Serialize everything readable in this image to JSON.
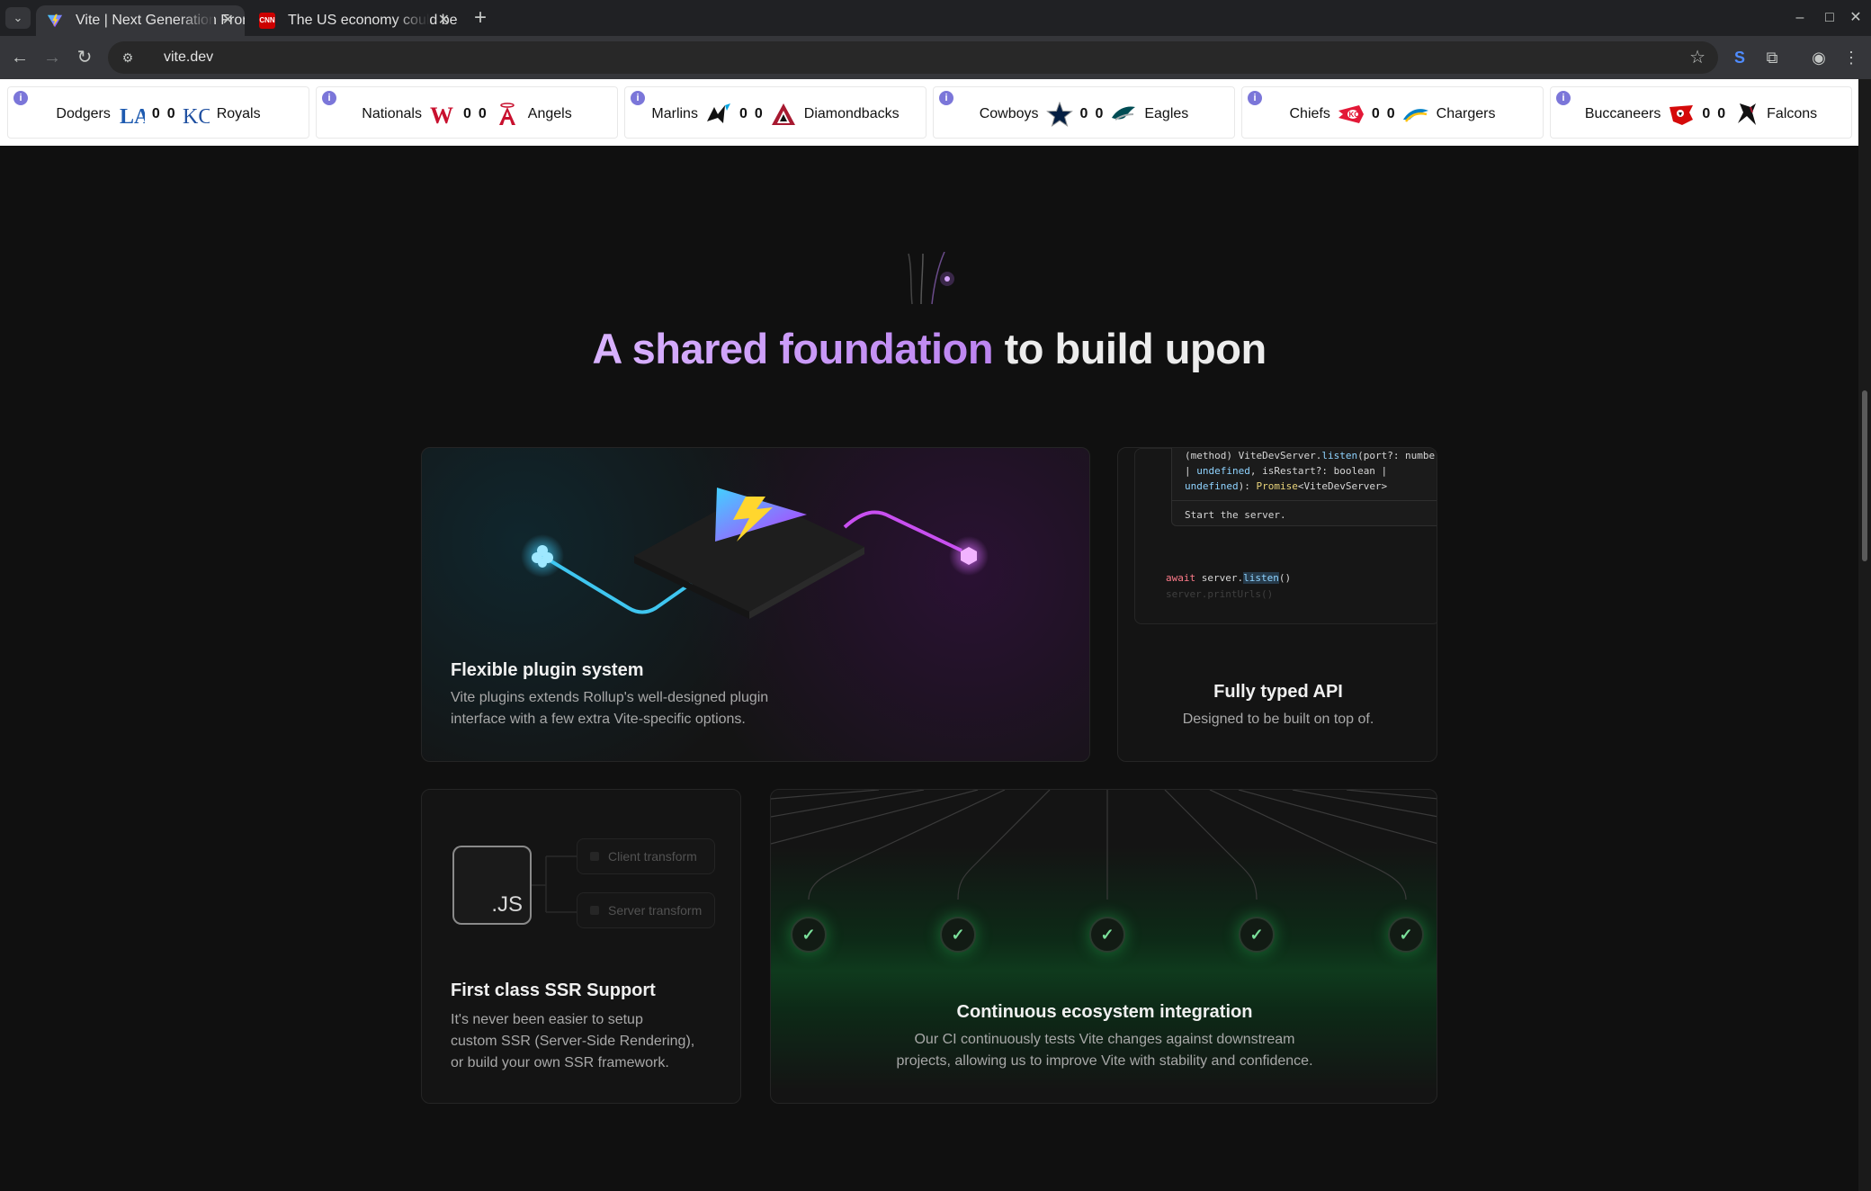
{
  "browser": {
    "tabs": [
      {
        "title": "Vite | Next Generation Frontend Tooling",
        "active": true
      },
      {
        "title": "The US economy could be in for a rough ride",
        "active": false
      }
    ],
    "url": "vite.dev"
  },
  "scores": [
    {
      "away": "Dodgers",
      "away_score": "0",
      "home_score": "0",
      "home": "Royals"
    },
    {
      "away": "Nationals",
      "away_score": "0",
      "home_score": "0",
      "home": "Angels"
    },
    {
      "away": "Marlins",
      "away_score": "0",
      "home_score": "0",
      "home": "Diamondbacks"
    },
    {
      "away": "Cowboys",
      "away_score": "0",
      "home_score": "0",
      "home": "Eagles"
    },
    {
      "away": "Chiefs",
      "away_score": "0",
      "home_score": "0",
      "home": "Chargers"
    },
    {
      "away": "Buccaneers",
      "away_score": "0",
      "home_score": "0",
      "home": "Falcons"
    }
  ],
  "section": {
    "heading_accent": "A shared foundation",
    "heading_rest": " to build upon"
  },
  "cards": {
    "plugin": {
      "title": "Flexible plugin system",
      "desc_line1": "Vite plugins extends Rollup's well-designed plugin",
      "desc_line2": "interface with a few extra Vite-specific options."
    },
    "typed": {
      "title": "Fully typed API",
      "desc": "Designed to be built on top of.",
      "tooltip": {
        "method": "(method) ViteDevServer.",
        "fn": "listen",
        "params1": "(port?: number",
        "line2_a": "| ",
        "line2_b": "undefined",
        "line2_c": ", isRestart?: boolean |",
        "line3_a": "undefined",
        "line3_b": "): ",
        "line3_c": "Promise",
        "line3_d": "<ViteDevServer>",
        "doc": "Start the server."
      },
      "code_line1_kw": "await",
      "code_line1_obj": " server.",
      "code_line1_fn": "listen",
      "code_line1_end": "()",
      "code_line2": "server.printUrls()"
    },
    "ssr": {
      "title": "First class SSR Support",
      "desc_line1": "It's never been easier to setup",
      "desc_line2": "custom SSR (Server-Side Rendering),",
      "desc_line3": "or build your own SSR framework.",
      "js_label": ".JS",
      "client": "Client transform",
      "server": "Server transform"
    },
    "ci": {
      "title": "Continuous ecosystem integration",
      "desc_line1": "Our CI continuously tests Vite changes against downstream",
      "desc_line2": "projects, allowing us to improve Vite with stability and confidence."
    }
  },
  "colors": {
    "accent_purple": "#c894f5",
    "vite_blue": "#41d1ff",
    "vite_purple": "#bd34fe",
    "ci_green": "#2bc45f"
  }
}
